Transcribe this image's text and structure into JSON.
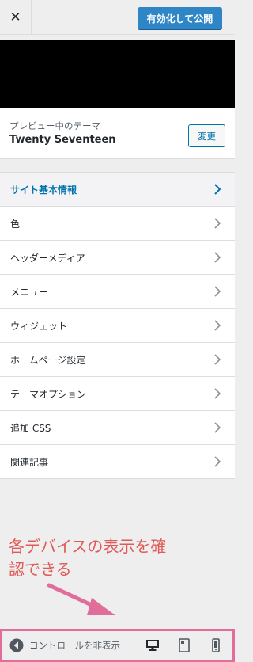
{
  "header": {
    "close_glyph": "✕",
    "publish_label": "有効化して公開"
  },
  "theme": {
    "caption": "プレビュー中のテーマ",
    "name": "Twenty Seventeen",
    "change_label": "変更"
  },
  "menu": {
    "items": [
      {
        "label": "サイト基本情報"
      },
      {
        "label": "色"
      },
      {
        "label": "ヘッダーメディア"
      },
      {
        "label": "メニュー"
      },
      {
        "label": "ウィジェット"
      },
      {
        "label": "ホームページ設定"
      },
      {
        "label": "テーマオプション"
      },
      {
        "label": "追加 CSS"
      },
      {
        "label": "関連記事"
      }
    ]
  },
  "annotation": {
    "line1": "各デバイスの表示を確",
    "line2": "認できる"
  },
  "controls": {
    "collapse_label": "コントロールを非表示"
  },
  "colors": {
    "accent": "#0073aa",
    "publish": "#2e86c7",
    "annotation": "#e05a5a",
    "highlight_border": "#e06d9a"
  },
  "icons": {
    "close": "close-icon",
    "chevron": "chevron-right-icon",
    "collapse": "collapse-arrow-icon",
    "desktop": "desktop-icon",
    "tablet": "tablet-icon",
    "mobile": "mobile-icon"
  }
}
